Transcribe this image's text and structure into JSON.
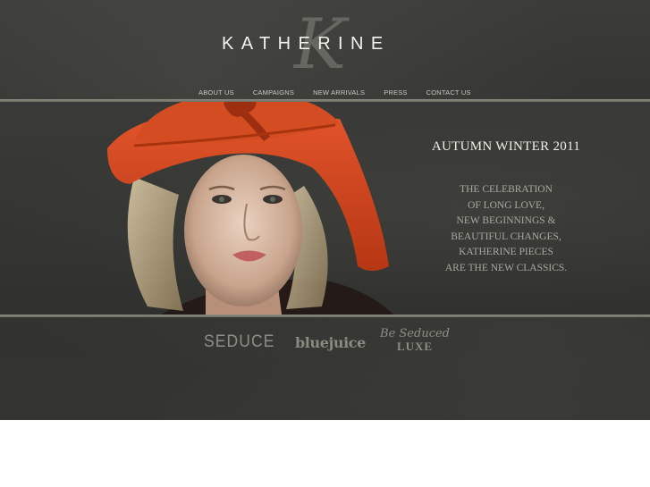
{
  "brand": {
    "name": "KATHERINE",
    "monogram": "K"
  },
  "nav": {
    "items": [
      {
        "label": "ABOUT US"
      },
      {
        "label": "CAMPAIGNS"
      },
      {
        "label": "NEW ARRIVALS"
      },
      {
        "label": "PRESS"
      },
      {
        "label": "CONTACT US"
      }
    ]
  },
  "hero": {
    "title": "AUTUMN WINTER 2011",
    "tagline": [
      "THE CELEBRATION",
      "OF LONG LOVE,",
      "NEW BEGINNINGS &",
      "BEAUTIFUL CHANGES,",
      "KATHERINE PIECES",
      "ARE THE NEW CLASSICS."
    ]
  },
  "sub_brands": {
    "seduce": "SEDUCE",
    "bluejuice": "bluejuice",
    "luxe_script": "Be Seduced",
    "luxe_caps": "LUXE"
  },
  "colors": {
    "hat": "#d8481f",
    "background": "#333431",
    "rule": "#7d7d72"
  }
}
